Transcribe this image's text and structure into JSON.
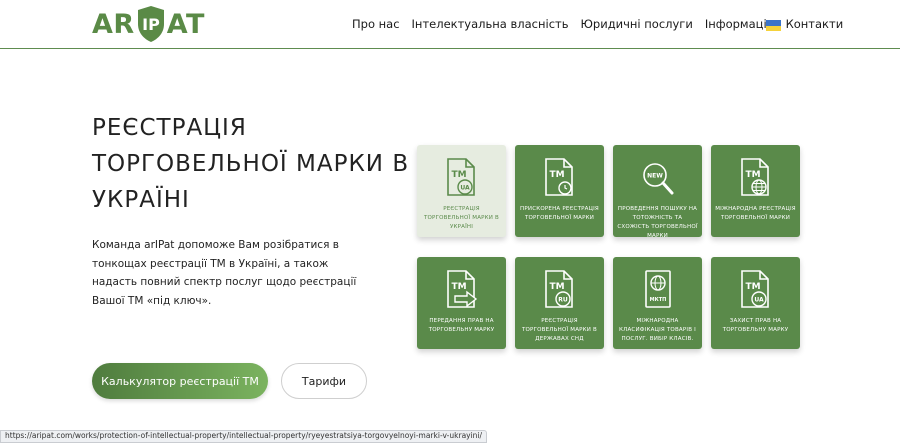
{
  "header": {
    "logo_left": "AR",
    "logo_mid": "IP",
    "logo_right": "AT",
    "nav": [
      "Про нас",
      "Інтелектуальна власність",
      "Юридичні послуги",
      "Інформація",
      "Контакти"
    ],
    "flag_name": "ukraine-flag-icon"
  },
  "hero": {
    "title_lines": [
      "РЕЄСТРАЦІЯ",
      "ТОРГОВЕЛЬНОЇ МАРКИ В",
      "УКРАЇНІ"
    ],
    "description": "Команда arIPat допоможе Вам розібратися в тонкощах реєстрації ТМ в Україні, а також надасть повний спектр послуг щодо реєстрації Вашої ТМ «під ключ».",
    "calc_button": "Калькулятор реєстрації ТМ",
    "tariff_button": "Тарифи"
  },
  "cards": [
    {
      "label": "Реєстрація торговельної марки в Україні",
      "icon": "tm-ua-icon",
      "active": true
    },
    {
      "label": "Прискорена реєстрація торговельної марки",
      "icon": "tm-timer-icon",
      "active": false
    },
    {
      "label": "Проведення пошуку на тотожність та схожість торговельної марки",
      "icon": "new-search-icon",
      "active": false
    },
    {
      "label": "Міжнародна реєстрація торговельної марки",
      "icon": "tm-globe-icon",
      "active": false
    },
    {
      "label": "Передання прав на торговельну марку",
      "icon": "tm-transfer-icon",
      "active": false
    },
    {
      "label": "Реєстрація торговельної марки в державах СНД",
      "icon": "tm-ru-icon",
      "active": false
    },
    {
      "label": "Міжнародна класифікація товарів і послуг. Вибір класів.",
      "icon": "mktp-globe-icon",
      "active": false
    },
    {
      "label": "Захист прав на торговельну марку",
      "icon": "tm-ua-protect-icon",
      "active": false
    }
  ],
  "status_url": "https://aripat.com/works/protection-of-intellectual-property/intellectual-property/ryeyestratsiya-torgovyelnoyi-marki-v-ukrayini/",
  "colors": {
    "brand_green": "#5a8a4a",
    "active_card_bg": "#e6ece0",
    "flag_blue": "#3a73c9",
    "flag_yellow": "#f5d23b"
  }
}
